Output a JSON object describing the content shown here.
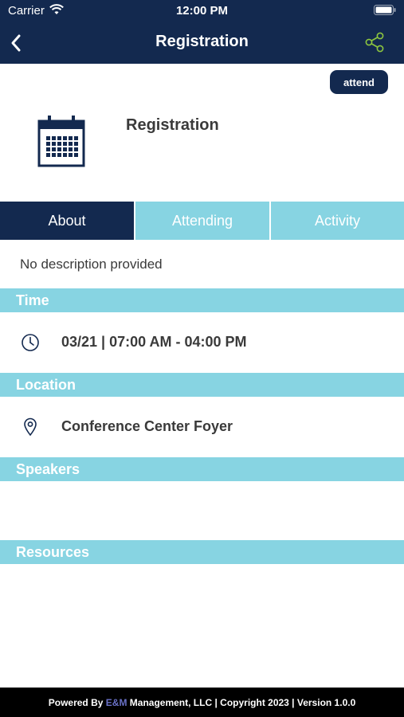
{
  "status_bar": {
    "carrier": "Carrier",
    "time": "12:00 PM"
  },
  "nav": {
    "title": "Registration",
    "back_icon": "chevron-left-icon",
    "share_icon": "share-icon"
  },
  "attend_button": {
    "label": "attend"
  },
  "session": {
    "title": "Registration",
    "icon": "calendar-icon"
  },
  "tabs": [
    {
      "label": "About",
      "active": true
    },
    {
      "label": "Attending",
      "active": false
    },
    {
      "label": "Activity",
      "active": false
    }
  ],
  "about": {
    "description": "No description provided",
    "sections": {
      "time": {
        "header": "Time",
        "value": "03/21 | 07:00 AM - 04:00 PM",
        "icon": "clock-icon"
      },
      "location": {
        "header": "Location",
        "value": "Conference Center Foyer",
        "icon": "map-pin-icon"
      },
      "speakers": {
        "header": "Speakers"
      },
      "resources": {
        "header": "Resources"
      }
    }
  },
  "footer": {
    "prefix": "Powered By ",
    "brand": "E&M",
    "suffix": " Management, LLC | Copyright 2023 | Version 1.0.0"
  },
  "colors": {
    "navy": "#13294f",
    "accent_teal": "#87d4e2",
    "share_icon_green": "#8dc63f",
    "footer_bg": "#000000",
    "brand_text": "#6a72c8"
  }
}
